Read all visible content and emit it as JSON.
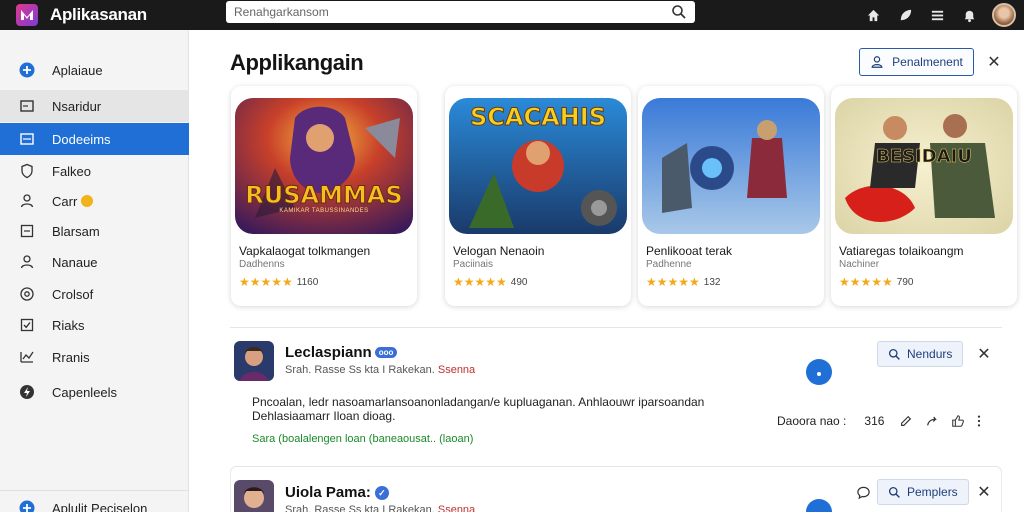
{
  "app": {
    "title": "Aplikasanan",
    "accent_color": "#1f6fd6"
  },
  "search": {
    "placeholder": "Renahgarkansom",
    "icon": "search-icon"
  },
  "topbar_icons": [
    "home-icon",
    "leaf-icon",
    "menu-icon",
    "bell-icon",
    "avatar"
  ],
  "sidebar": {
    "items": [
      {
        "label": "Aplaiaue",
        "icon": "plus-circle-icon"
      },
      {
        "label": "Nsaridur",
        "icon": "square-icon"
      },
      {
        "label": "Dodeeims",
        "icon": "card-icon",
        "active": true
      },
      {
        "label": "Falkeo",
        "icon": "shield-icon"
      },
      {
        "label": "Carr",
        "icon": "user-icon",
        "badge": "coin"
      },
      {
        "label": "Blarsam",
        "icon": "list-icon"
      },
      {
        "label": "Nanaue",
        "icon": "person-icon"
      },
      {
        "label": "Crolsof",
        "icon": "target-icon"
      },
      {
        "label": "Riaks",
        "icon": "check-box-icon"
      },
      {
        "label": "Rranis",
        "icon": "graph-icon"
      },
      {
        "label": "Capenleels",
        "icon": "lightning-icon"
      }
    ],
    "bottom_item": {
      "label": "Aplulit Peciselon",
      "icon": "plus-circle-icon"
    }
  },
  "main": {
    "title": "Applikangain",
    "header_button": {
      "label": "Penalmenent",
      "icon": "person-icon"
    }
  },
  "cards": [
    {
      "title": "Vapkalaogat tolkmangen",
      "subtitle": "Dadhenns",
      "stars": "★★★★★",
      "rating": "1160",
      "art_label": "RUSAMMAS",
      "art_sub": "KAMIKAR TABUSSINANDES"
    },
    {
      "title": "Velogan Nenaoin",
      "subtitle": "Paciinais",
      "stars": "★★★★★",
      "rating": "490",
      "art_label": "SCACAHIS"
    },
    {
      "title": "Penlikooat terak",
      "subtitle": "Padhenne",
      "stars": "★★★★★",
      "rating": "132"
    },
    {
      "title": "Vatiaregas tolaikoangm",
      "subtitle": "Nachiner",
      "stars": "★★★★★",
      "rating": "790",
      "art_label": "BESIDAIU"
    }
  ],
  "posts": [
    {
      "name": "Leclaspiann",
      "tag": "ooo",
      "meta": "Srah. Rasse Ss kta I Rakekan.",
      "meta_highlight": "Ssenna",
      "body": "Pncoalan, ledr nasoamarlansoanonladangan/e kupluaganan. Anhlaouwr iparsoandan Dehlasiaamarr Iloan dioag.",
      "green_text": "Sara (boalalengen loan (baneaousat.. (laoan)",
      "button": {
        "label": "Nendurs",
        "icon": "search-icon"
      },
      "actions": {
        "label": "Daoora nao :",
        "count": "316"
      }
    },
    {
      "name": "Uiola Pama:",
      "verified": "✓",
      "meta": "Srah. Rasse Ss kta I Rakekan.",
      "meta_highlight": "Ssenna",
      "button": {
        "label": "Pemplers",
        "icon": "search-icon"
      }
    }
  ]
}
